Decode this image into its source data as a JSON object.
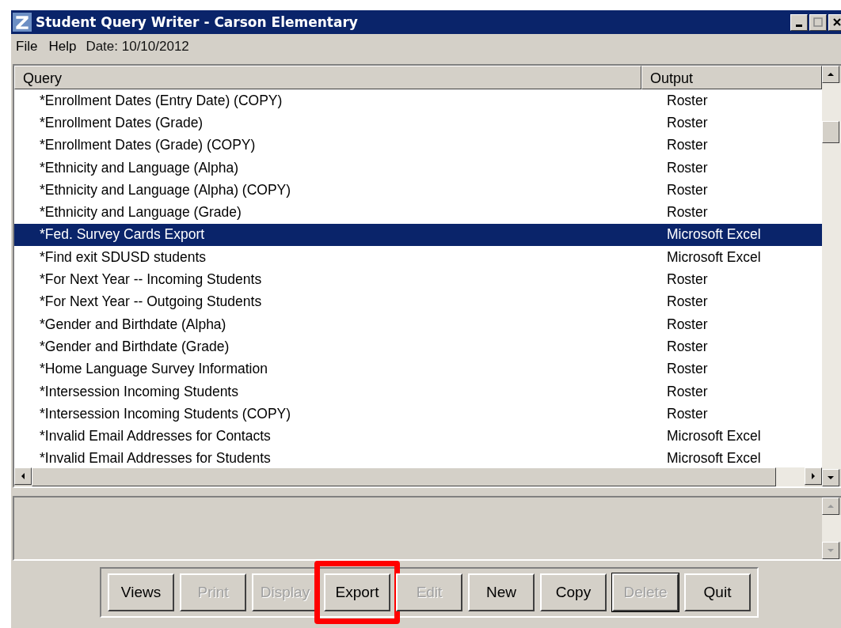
{
  "window": {
    "title": "Student Query Writer - Carson Elementary"
  },
  "menu": [
    {
      "label": "File"
    },
    {
      "label": "Help"
    },
    {
      "label": "Date: 10/10/2012",
      "kind": "info"
    }
  ],
  "table": {
    "columns": [
      "Query",
      "Output"
    ],
    "rows": [
      {
        "query": "*Enrollment Dates (Entry Date) (COPY)",
        "output": "Roster",
        "selected": false
      },
      {
        "query": "*Enrollment Dates (Grade)",
        "output": "Roster",
        "selected": false
      },
      {
        "query": "*Enrollment Dates (Grade) (COPY)",
        "output": "Roster",
        "selected": false
      },
      {
        "query": "*Ethnicity and Language (Alpha)",
        "output": "Roster",
        "selected": false
      },
      {
        "query": "*Ethnicity and Language (Alpha) (COPY)",
        "output": "Roster",
        "selected": false
      },
      {
        "query": "*Ethnicity and Language (Grade)",
        "output": "Roster",
        "selected": false
      },
      {
        "query": "*Fed. Survey Cards Export",
        "output": "Microsoft Excel",
        "selected": true
      },
      {
        "query": "*Find exit SDUSD students",
        "output": "Microsoft Excel",
        "selected": false
      },
      {
        "query": "*For Next Year -- Incoming Students",
        "output": "Roster",
        "selected": false
      },
      {
        "query": "*For Next Year -- Outgoing Students",
        "output": "Roster",
        "selected": false
      },
      {
        "query": "*Gender and Birthdate (Alpha)",
        "output": "Roster",
        "selected": false
      },
      {
        "query": "*Gender and Birthdate (Grade)",
        "output": "Roster",
        "selected": false
      },
      {
        "query": "*Home Language Survey Information",
        "output": "Roster",
        "selected": false
      },
      {
        "query": "*Intersession Incoming Students",
        "output": "Roster",
        "selected": false
      },
      {
        "query": "*Intersession Incoming Students (COPY)",
        "output": "Roster",
        "selected": false
      },
      {
        "query": "*Invalid Email Addresses for Contacts",
        "output": "Microsoft Excel",
        "selected": false
      },
      {
        "query": "*Invalid Email Addresses for Students",
        "output": "Microsoft Excel",
        "selected": false
      }
    ]
  },
  "buttons": [
    {
      "label": "Views",
      "disabled": false,
      "highlighted": false,
      "default": false
    },
    {
      "label": "Print",
      "disabled": true,
      "highlighted": false,
      "default": false
    },
    {
      "label": "Display",
      "disabled": true,
      "highlighted": false,
      "default": false
    },
    {
      "label": "Export",
      "disabled": false,
      "highlighted": true,
      "default": false
    },
    {
      "label": "Edit",
      "disabled": true,
      "highlighted": false,
      "default": false
    },
    {
      "label": "New",
      "disabled": false,
      "highlighted": false,
      "default": false
    },
    {
      "label": "Copy",
      "disabled": false,
      "highlighted": false,
      "default": false
    },
    {
      "label": "Delete",
      "disabled": true,
      "highlighted": false,
      "default": true
    },
    {
      "label": "Quit",
      "disabled": false,
      "highlighted": false,
      "default": false
    }
  ]
}
